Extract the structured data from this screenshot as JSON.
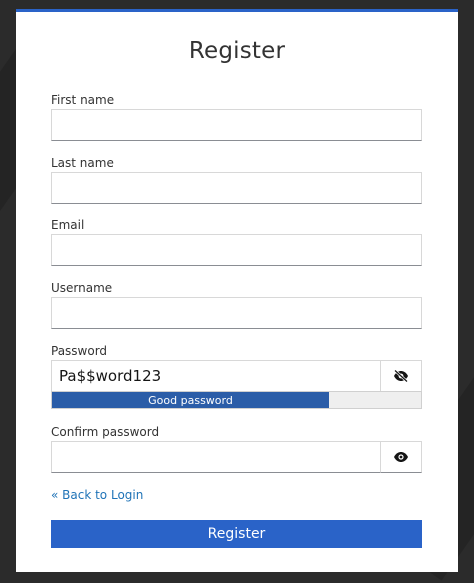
{
  "page": {
    "title": "Register",
    "accent_color": "#2a63c8"
  },
  "fields": {
    "first_name": {
      "label": "First name",
      "value": ""
    },
    "last_name": {
      "label": "Last name",
      "value": ""
    },
    "email": {
      "label": "Email",
      "value": ""
    },
    "username": {
      "label": "Username",
      "value": ""
    },
    "password": {
      "label": "Password",
      "value": "Pa$$word123",
      "toggle_icon": "eye-slash-icon"
    },
    "confirm_password": {
      "label": "Confirm password",
      "value": "",
      "toggle_icon": "eye-icon"
    }
  },
  "password_strength": {
    "text": "Good password",
    "level_fraction": 0.75,
    "fill_color": "#2b5da8"
  },
  "links": {
    "back_to_login": "« Back to Login"
  },
  "actions": {
    "submit_label": "Register"
  }
}
